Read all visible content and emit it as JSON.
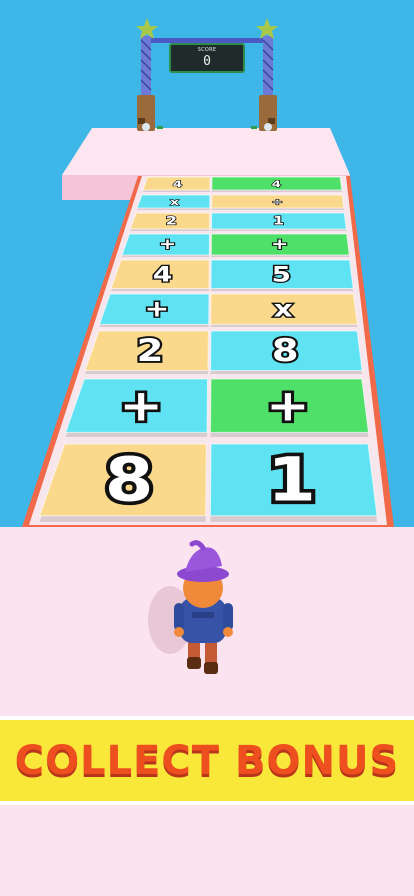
{
  "scoreboard": {
    "label": "SCORE",
    "value": "0"
  },
  "track": {
    "rows": [
      {
        "left": "4",
        "right": "4",
        "left_color": "yellow",
        "right_color": "green"
      },
      {
        "left": "x",
        "right": "÷",
        "left_color": "cyan",
        "right_color": "yellow"
      },
      {
        "left": "2",
        "right": "1",
        "left_color": "yellow",
        "right_color": "cyan"
      },
      {
        "left": "+",
        "right": "+",
        "left_color": "cyan",
        "right_color": "green"
      },
      {
        "left": "4",
        "right": "5",
        "left_color": "yellow",
        "right_color": "cyan"
      },
      {
        "left": "+",
        "right": "x",
        "left_color": "cyan",
        "right_color": "yellow"
      },
      {
        "left": "2",
        "right": "8",
        "left_color": "yellow",
        "right_color": "cyan"
      },
      {
        "left": "+",
        "right": "+",
        "left_color": "cyan",
        "right_color": "green"
      },
      {
        "left": "8",
        "right": "1",
        "left_color": "yellow",
        "right_color": "cyan"
      }
    ]
  },
  "colors": {
    "sky": "#3fb6e8",
    "yellow": "#fbd98c",
    "cyan": "#5fe3f2",
    "green": "#4fe06a",
    "platform": "#fbe3ef",
    "track_border": "#f06a4a"
  },
  "player": {
    "name": "wizard-hat-runner"
  },
  "banner": {
    "text": "COLLECT BONUS"
  }
}
